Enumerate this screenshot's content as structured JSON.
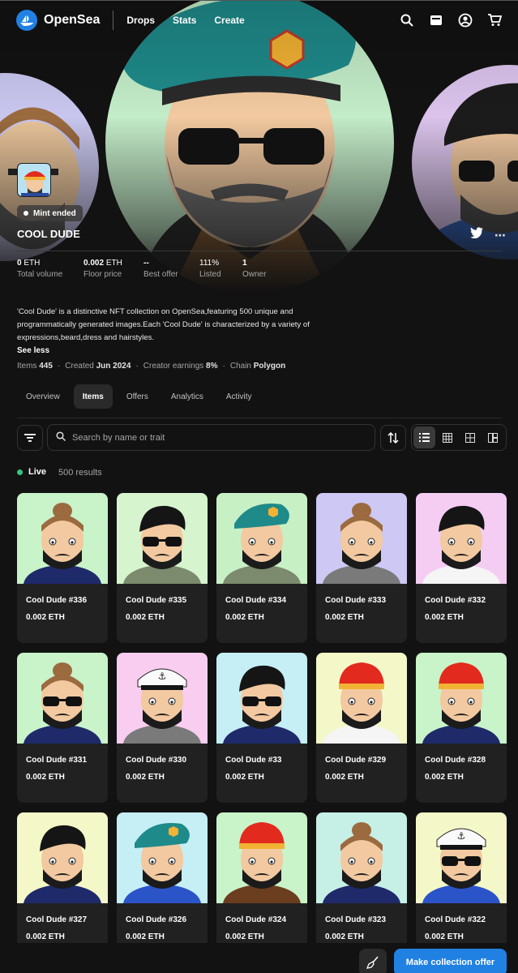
{
  "nav": {
    "brand": "OpenSea",
    "links": [
      "Drops",
      "Stats",
      "Create"
    ],
    "icons": [
      "search-icon",
      "wallet-icon",
      "account-icon",
      "cart-icon"
    ]
  },
  "collection": {
    "badge": "Mint ended",
    "title": "COOL DUDE",
    "stats": [
      {
        "value": "0",
        "unit": "ETH",
        "label": "Total volume"
      },
      {
        "value": "0.002",
        "unit": "ETH",
        "label": "Floor price"
      },
      {
        "value": "--",
        "unit": "",
        "label": "Best offer"
      },
      {
        "value": "111%",
        "unit": "",
        "label": "Listed"
      },
      {
        "value": "1",
        "unit": "",
        "label": "Owner"
      }
    ],
    "description_lines": [
      "'Cool Dude' is a distinctive NFT collection on OpenSea,featuring 500 unique and",
      "programmatically generated images.Each 'Cool Dude' is characterized by a variety of",
      "expressions,beard,dress and hairstyles."
    ],
    "see_less": "See less",
    "meta": {
      "items_label": "Items",
      "items_value": "445",
      "created_label": "Created",
      "created_value": "Jun 2024",
      "earnings_label": "Creator earnings",
      "earnings_value": "8%",
      "chain_label": "Chain",
      "chain_value": "Polygon"
    }
  },
  "tabs": [
    "Overview",
    "Items",
    "Offers",
    "Analytics",
    "Activity"
  ],
  "active_tab": "Items",
  "search": {
    "placeholder": "Search by name or trait"
  },
  "status": {
    "live": "Live",
    "results": "500 results"
  },
  "items": [
    {
      "name": "Cool Dude #336",
      "price": "0.002 ETH",
      "bg": "#c9f3c9",
      "hair": "bun",
      "glasses": false,
      "outfit": "navy"
    },
    {
      "name": "Cool Dude #335",
      "price": "0.002 ETH",
      "bg": "#d6f5cf",
      "hair": "black",
      "glasses": true,
      "outfit": "olive"
    },
    {
      "name": "Cool Dude #334",
      "price": "0.002 ETH",
      "bg": "#c8f0c5",
      "hair": "beret",
      "glasses": false,
      "outfit": "olive"
    },
    {
      "name": "Cool Dude #333",
      "price": "0.002 ETH",
      "bg": "#cdc8f4",
      "hair": "bun",
      "glasses": false,
      "outfit": "grey"
    },
    {
      "name": "Cool Dude #332",
      "price": "0.002 ETH",
      "bg": "#f5cdf3",
      "hair": "black",
      "glasses": false,
      "outfit": "white"
    },
    {
      "name": "Cool Dude #331",
      "price": "0.002 ETH",
      "bg": "#c9f3c9",
      "hair": "bun",
      "glasses": true,
      "outfit": "navy"
    },
    {
      "name": "Cool Dude #330",
      "price": "0.002 ETH",
      "bg": "#f8cdef",
      "hair": "captain",
      "glasses": false,
      "outfit": "grey"
    },
    {
      "name": "Cool Dude #33",
      "price": "0.002 ETH",
      "bg": "#c6eef5",
      "hair": "black",
      "glasses": true,
      "outfit": "navy"
    },
    {
      "name": "Cool Dude #329",
      "price": "0.002 ETH",
      "bg": "#f4f8c8",
      "hair": "beanie",
      "glasses": false,
      "outfit": "white"
    },
    {
      "name": "Cool Dude #328",
      "price": "0.002 ETH",
      "bg": "#c9f3c9",
      "hair": "beanie",
      "glasses": false,
      "outfit": "navy"
    },
    {
      "name": "Cool Dude #327",
      "price": "0.002 ETH",
      "bg": "#f4f8c8",
      "hair": "black",
      "glasses": false,
      "outfit": "navy"
    },
    {
      "name": "Cool Dude #326",
      "price": "0.002 ETH",
      "bg": "#c6eef5",
      "hair": "beret",
      "glasses": false,
      "outfit": "blue"
    },
    {
      "name": "Cool Dude #324",
      "price": "0.002 ETH",
      "bg": "#c9f3c9",
      "hair": "beanie",
      "glasses": false,
      "outfit": "brown"
    },
    {
      "name": "Cool Dude #323",
      "price": "0.002 ETH",
      "bg": "#c6f0e6",
      "hair": "bun",
      "glasses": false,
      "outfit": "navy"
    },
    {
      "name": "Cool Dude #322",
      "price": "0.002 ETH",
      "bg": "#f4f8c8",
      "hair": "captain",
      "glasses": true,
      "outfit": "blue"
    }
  ],
  "bottom": {
    "offer_button": "Make collection offer"
  },
  "colors": {
    "accent": "#2081e2",
    "live": "#34c77b",
    "background": "#121212",
    "card": "#212121"
  }
}
